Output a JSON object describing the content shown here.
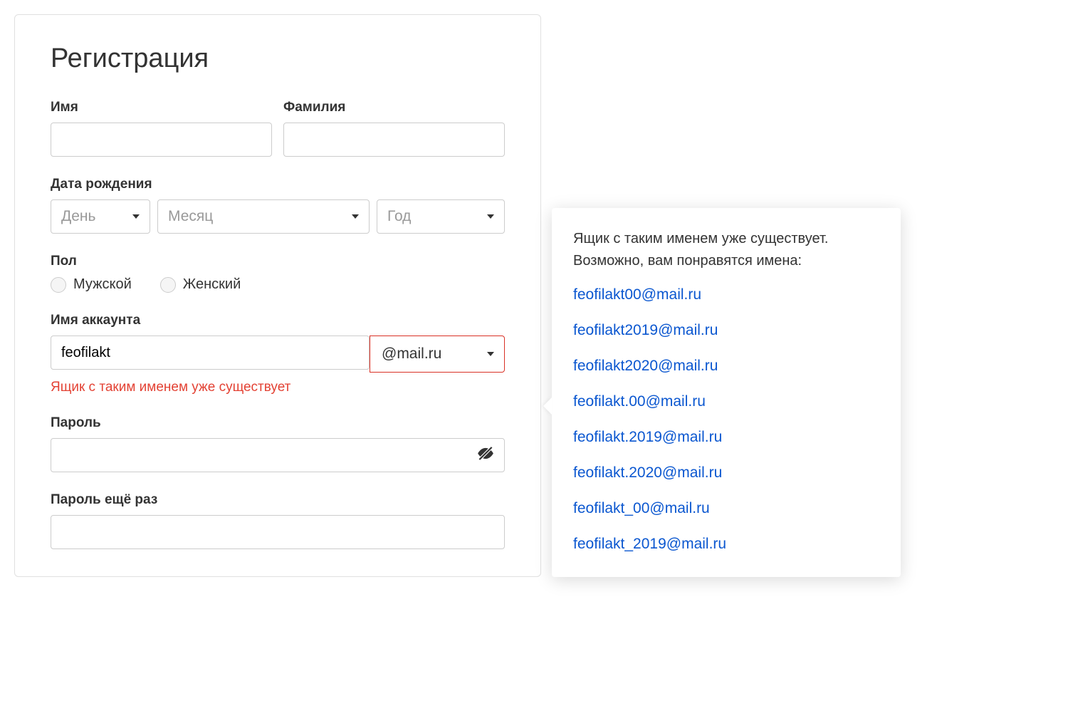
{
  "form": {
    "title": "Регистрация",
    "firstname_label": "Имя",
    "lastname_label": "Фамилия",
    "dob_label": "Дата рождения",
    "day_placeholder": "День",
    "month_placeholder": "Месяц",
    "year_placeholder": "Год",
    "gender_label": "Пол",
    "gender_male": "Мужской",
    "gender_female": "Женский",
    "account_label": "Имя аккаунта",
    "account_value": "feofilakt",
    "domain_value": "@mail.ru",
    "account_error": "Ящик с таким именем уже существует",
    "password_label": "Пароль",
    "password_repeat_label": "Пароль ещё раз"
  },
  "popup": {
    "line1": "Ящик с таким именем уже существует.",
    "line2": "Возможно, вам понравятся имена:",
    "suggestions": [
      "feofilakt00@mail.ru",
      "feofilakt2019@mail.ru",
      "feofilakt2020@mail.ru",
      "feofilakt.00@mail.ru",
      "feofilakt.2019@mail.ru",
      "feofilakt.2020@mail.ru",
      "feofilakt_00@mail.ru",
      "feofilakt_2019@mail.ru"
    ]
  }
}
